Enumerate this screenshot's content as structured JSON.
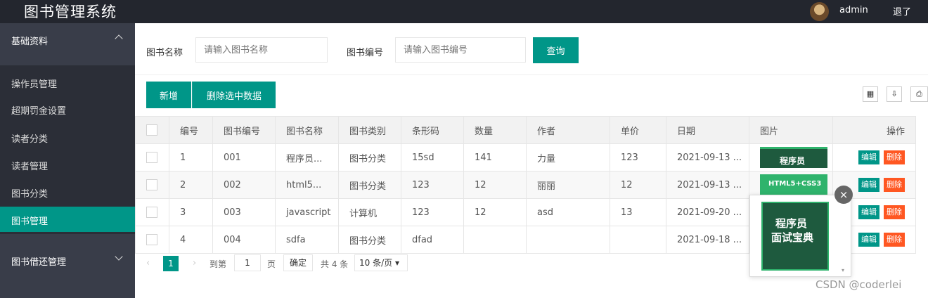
{
  "header": {
    "title": "图书管理系统",
    "user": "admin",
    "logout": "退了"
  },
  "sidebar": {
    "group1": "基础资料",
    "items": [
      "操作员管理",
      "超期罚金设置",
      "读者分类",
      "读者管理",
      "图书分类",
      "图书管理"
    ],
    "group2": "图书借还管理"
  },
  "search": {
    "name_label": "图书名称",
    "name_placeholder": "请输入图书名称",
    "code_label": "图书编号",
    "code_placeholder": "请输入图书编号",
    "query": "查询"
  },
  "toolbar": {
    "add": "新增",
    "delete_selected": "删除选中数据"
  },
  "table": {
    "headers": [
      "编号",
      "图书编号",
      "图书名称",
      "图书类别",
      "条形码",
      "数量",
      "作者",
      "单价",
      "日期",
      "图片",
      "操作"
    ],
    "edit": "编辑",
    "delete": "删除",
    "rows": [
      {
        "id": "1",
        "code": "001",
        "name": "程序员...",
        "category": "图书分类",
        "barcode": "15sd",
        "qty": "141",
        "author": "力量",
        "price": "123",
        "date": "2021-09-13 ...",
        "img": "程序员"
      },
      {
        "id": "2",
        "code": "002",
        "name": "html5...",
        "category": "图书分类",
        "barcode": "123",
        "qty": "12",
        "author": "丽丽",
        "price": "12",
        "date": "2021-09-13 ...",
        "img": "HTML5+CSS3"
      },
      {
        "id": "3",
        "code": "003",
        "name": "javascript",
        "category": "计算机",
        "barcode": "123",
        "qty": "12",
        "author": "asd",
        "price": "13",
        "date": "2021-09-20 ...",
        "img": ""
      },
      {
        "id": "4",
        "code": "004",
        "name": "sdfa",
        "category": "图书分类",
        "barcode": "dfad",
        "qty": "",
        "author": "",
        "price": "",
        "date": "2021-09-18 ...",
        "img": ""
      }
    ]
  },
  "pager": {
    "current": "1",
    "goto": "到第",
    "page_input": "1",
    "page": "页",
    "confirm": "确定",
    "total": "共 4 条",
    "size": "10 条/页"
  },
  "popup": {
    "title_line1": "程序员",
    "title_line2": "面试宝典",
    "close": "×"
  },
  "watermark": "CSDN @coderlei"
}
